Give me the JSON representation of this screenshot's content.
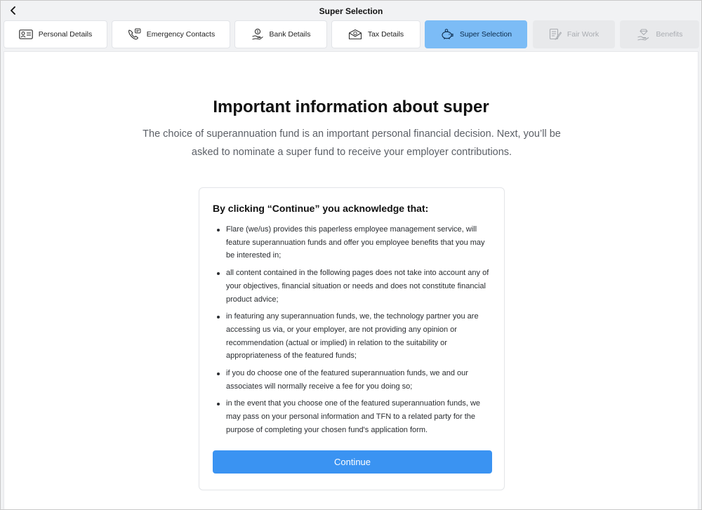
{
  "header": {
    "title": "Super Selection"
  },
  "tabs": [
    {
      "label": "Personal Details",
      "icon": "id-card-icon",
      "state": "default"
    },
    {
      "label": "Emergency Contacts",
      "icon": "phone-icon",
      "state": "default"
    },
    {
      "label": "Bank Details",
      "icon": "hand-coin-icon",
      "state": "default"
    },
    {
      "label": "Tax Details",
      "icon": "envelope-money-icon",
      "state": "default"
    },
    {
      "label": "Super Selection",
      "icon": "piggy-bank-icon",
      "state": "active"
    },
    {
      "label": "Fair Work",
      "icon": "document-pen-icon",
      "state": "disabled"
    },
    {
      "label": "Benefits",
      "icon": "hand-diamond-icon",
      "state": "disabled"
    }
  ],
  "main": {
    "heading": "Important information about super",
    "intro_line1": "The choice of superannuation fund is an important personal financial decision. Next, you’ll be",
    "intro_line2": "asked to nominate a super fund to receive your employer contributions.",
    "card": {
      "title": "By clicking “Continue” you acknowledge that:",
      "items": [
        "Flare (we/us) provides this paperless employee management service, will feature superannuation funds and offer you employee benefits that you may be interested in;",
        "all content contained in the following pages does not take into account any of your objectives, financial situation or needs and does not constitute financial product advice;",
        "in featuring any superannuation funds, we, the technology partner you are accessing us via, or your employer, are not providing any opinion or recommendation (actual or implied) in relation to the suitability or appropriateness of the featured funds;",
        "if you do choose one of the featured superannuation funds, we and our associates will normally receive a fee for you doing so;",
        "in the event that you choose one of the featured superannuation funds, we may pass on your personal information and TFN to a related party for the purpose of completing your chosen fund's application form."
      ],
      "continue_label": "Continue"
    }
  },
  "colors": {
    "accent": "#3a93f2",
    "active_tab": "#7cbcf6",
    "disabled_tab": "#e8e9eb"
  }
}
